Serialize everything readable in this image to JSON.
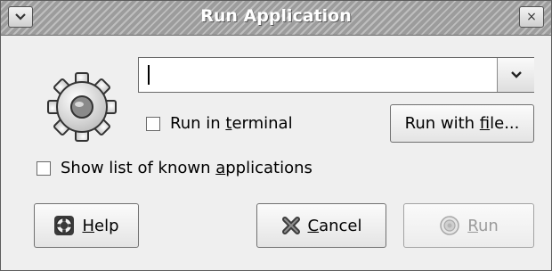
{
  "window": {
    "title": "Run Application",
    "menu_glyph": "⌄",
    "close_glyph": "×"
  },
  "command": {
    "value": "",
    "placeholder": "",
    "dropdown_icon": "chevron-down-icon"
  },
  "icons": {
    "main": "gear-icon",
    "help": "lifebuoy-icon",
    "cancel": "cancel-x-icon",
    "run": "run-icon"
  },
  "run_in_terminal": {
    "pre": "Run in ",
    "mnemonic": "t",
    "post": "erminal",
    "checked": false
  },
  "show_known_apps": {
    "pre": "Show list of known ",
    "mnemonic": "a",
    "post": "pplications",
    "checked": false
  },
  "buttons": {
    "run_with_file": {
      "pre": "Run with ",
      "mnemonic": "f",
      "post": "ile..."
    },
    "help": {
      "pre": "",
      "mnemonic": "H",
      "post": "elp"
    },
    "cancel": {
      "pre": "",
      "mnemonic": "C",
      "post": "ancel"
    },
    "run": {
      "pre": "",
      "mnemonic": "R",
      "post": "un",
      "enabled": false
    }
  },
  "colors": {
    "window_bg": "#efefef",
    "titlebar_bg": "#9c9c9c",
    "title_text": "#ffffff",
    "disabled_text": "#9a9a9a"
  }
}
